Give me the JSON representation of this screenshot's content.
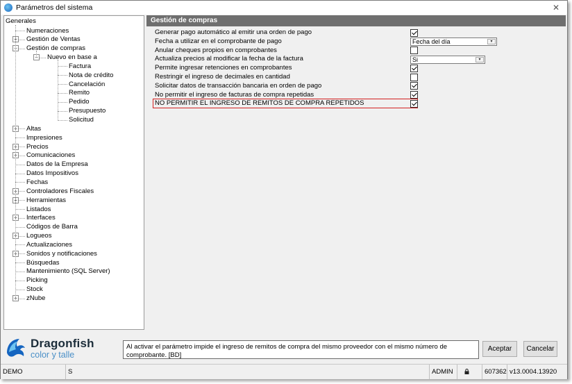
{
  "window": {
    "title": "Parámetros del sistema"
  },
  "tree": {
    "root": "Generales",
    "items": [
      {
        "label": "Numeraciones",
        "level": 1,
        "expander": ""
      },
      {
        "label": "Gestión de Ventas",
        "level": 1,
        "expander": "+"
      },
      {
        "label": "Gestión de compras",
        "level": 1,
        "expander": "-"
      },
      {
        "label": "Nuevo en base a",
        "level": 2,
        "expander": "-"
      },
      {
        "label": "Factura",
        "level": 3,
        "expander": ""
      },
      {
        "label": "Nota de crédito",
        "level": 3,
        "expander": ""
      },
      {
        "label": "Cancelación",
        "level": 3,
        "expander": ""
      },
      {
        "label": "Remito",
        "level": 3,
        "expander": ""
      },
      {
        "label": "Pedido",
        "level": 3,
        "expander": ""
      },
      {
        "label": "Presupuesto",
        "level": 3,
        "expander": ""
      },
      {
        "label": "Solicitud",
        "level": 3,
        "expander": ""
      },
      {
        "label": "Altas",
        "level": 1,
        "expander": "+"
      },
      {
        "label": "Impresiones",
        "level": 1,
        "expander": ""
      },
      {
        "label": "Precios",
        "level": 1,
        "expander": "+"
      },
      {
        "label": "Comunicaciones",
        "level": 1,
        "expander": "+"
      },
      {
        "label": "Datos de la Empresa",
        "level": 1,
        "expander": ""
      },
      {
        "label": "Datos Impositivos",
        "level": 1,
        "expander": ""
      },
      {
        "label": "Fechas",
        "level": 1,
        "expander": ""
      },
      {
        "label": "Controladores Fiscales",
        "level": 1,
        "expander": "+"
      },
      {
        "label": "Herramientas",
        "level": 1,
        "expander": "+"
      },
      {
        "label": "Listados",
        "level": 1,
        "expander": ""
      },
      {
        "label": "Interfaces",
        "level": 1,
        "expander": "+"
      },
      {
        "label": "Códigos de Barra",
        "level": 1,
        "expander": ""
      },
      {
        "label": "Logueos",
        "level": 1,
        "expander": "+"
      },
      {
        "label": "Actualizaciones",
        "level": 1,
        "expander": ""
      },
      {
        "label": "Sonidos y notificaciones",
        "level": 1,
        "expander": "+"
      },
      {
        "label": "Búsquedas",
        "level": 1,
        "expander": ""
      },
      {
        "label": "Mantenimiento (SQL Server)",
        "level": 1,
        "expander": ""
      },
      {
        "label": "Picking",
        "level": 1,
        "expander": ""
      },
      {
        "label": "Stock",
        "level": 1,
        "expander": ""
      },
      {
        "label": "zNube",
        "level": 1,
        "expander": "+"
      }
    ]
  },
  "panel": {
    "header": "Gestión de compras",
    "params": [
      {
        "label": "Generar pago automático al emitir una orden de pago",
        "control": "checkbox",
        "checked": true
      },
      {
        "label": "Fecha a utilizar en el comprobante de pago",
        "control": "select",
        "value": "Fecha del día"
      },
      {
        "label": "Anular cheques propios en comprobantes",
        "control": "checkbox",
        "checked": false
      },
      {
        "label": "Actualiza precios al modificar la fecha de la factura",
        "control": "select",
        "value": "Si"
      },
      {
        "label": "Permite ingresar retenciones en comprobantes",
        "control": "checkbox",
        "checked": true
      },
      {
        "label": "Restringir el ingreso de decimales en cantidad",
        "control": "checkbox",
        "checked": false
      },
      {
        "label": "Solicitar datos de transacción bancaria en orden de pago",
        "control": "checkbox",
        "checked": true
      },
      {
        "label": "No permitir el ingreso de facturas de compra repetidas",
        "control": "checkbox",
        "checked": true
      },
      {
        "label": "NO PERMITIR EL INGRESO DE REMITOS DE COMPRA REPETIDOS",
        "control": "checkbox",
        "checked": true,
        "highlighted": true
      }
    ]
  },
  "branding": {
    "name": "Dragonfish",
    "subtitle": "color y talle"
  },
  "description": "Al activar el parámetro impide el ingreso de remitos de compra del mismo proveedor con el mismo número de comprobante. [BD]",
  "buttons": {
    "accept": "Aceptar",
    "cancel": "Cancelar"
  },
  "status": {
    "mode": "DEMO",
    "flag": "S",
    "user": "ADMIN",
    "number": "607362",
    "version": "v13.0004.13920"
  },
  "colors": {
    "panel_header": "#6f6f6f",
    "highlight": "#d21f1f",
    "brand_dark": "#1c2d3a",
    "brand_light": "#4a8fc7"
  }
}
